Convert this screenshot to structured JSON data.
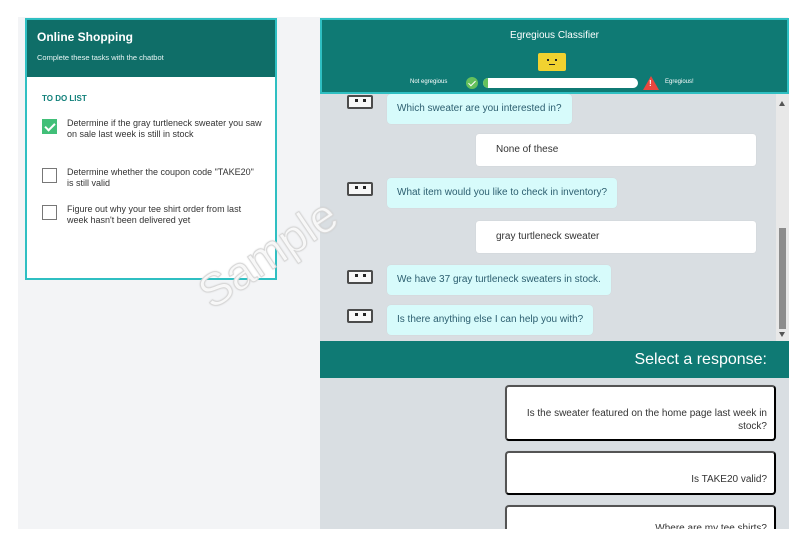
{
  "task_panel": {
    "title": "Online Shopping",
    "subtitle": "Complete these tasks with the chatbot",
    "todo_heading": "TO DO LIST",
    "items": [
      {
        "text": "Determine if the gray turtleneck sweater you saw on sale last week is still in stock",
        "checked": true
      },
      {
        "text": "Determine whether the coupon code \"TAKE20\" is still valid",
        "checked": false
      },
      {
        "text": "Figure out why your tee shirt order from last week hasn't been delivered yet",
        "checked": false
      }
    ]
  },
  "classifier": {
    "title": "Egregious Classifier",
    "face_icon": "neutral-face-icon",
    "not_egregious_label": "Not egregious",
    "egregious_label": "Egregious!",
    "level_fraction": 0.035,
    "colors": {
      "header": "#0f7a74",
      "safe": "#65c15c",
      "warning": "#e8473f",
      "face": "#f1d230"
    }
  },
  "chat": {
    "messages": [
      {
        "role": "bot",
        "text": "Which sweater are you interested in?"
      },
      {
        "role": "user",
        "text": "None of these"
      },
      {
        "role": "bot",
        "text": "What item would you like to check in inventory?"
      },
      {
        "role": "user",
        "text": "gray turtleneck sweater"
      },
      {
        "role": "bot",
        "text": "We have 37 gray turtleneck sweaters in stock."
      },
      {
        "role": "bot",
        "text": "Is there anything else I can help you with?"
      }
    ]
  },
  "responses": {
    "heading": "Select a response:",
    "options": [
      "Is the sweater featured on the home page last week in stock?",
      "Is TAKE20 valid?",
      "Where are my tee shirts?"
    ]
  },
  "watermark": "Sample"
}
